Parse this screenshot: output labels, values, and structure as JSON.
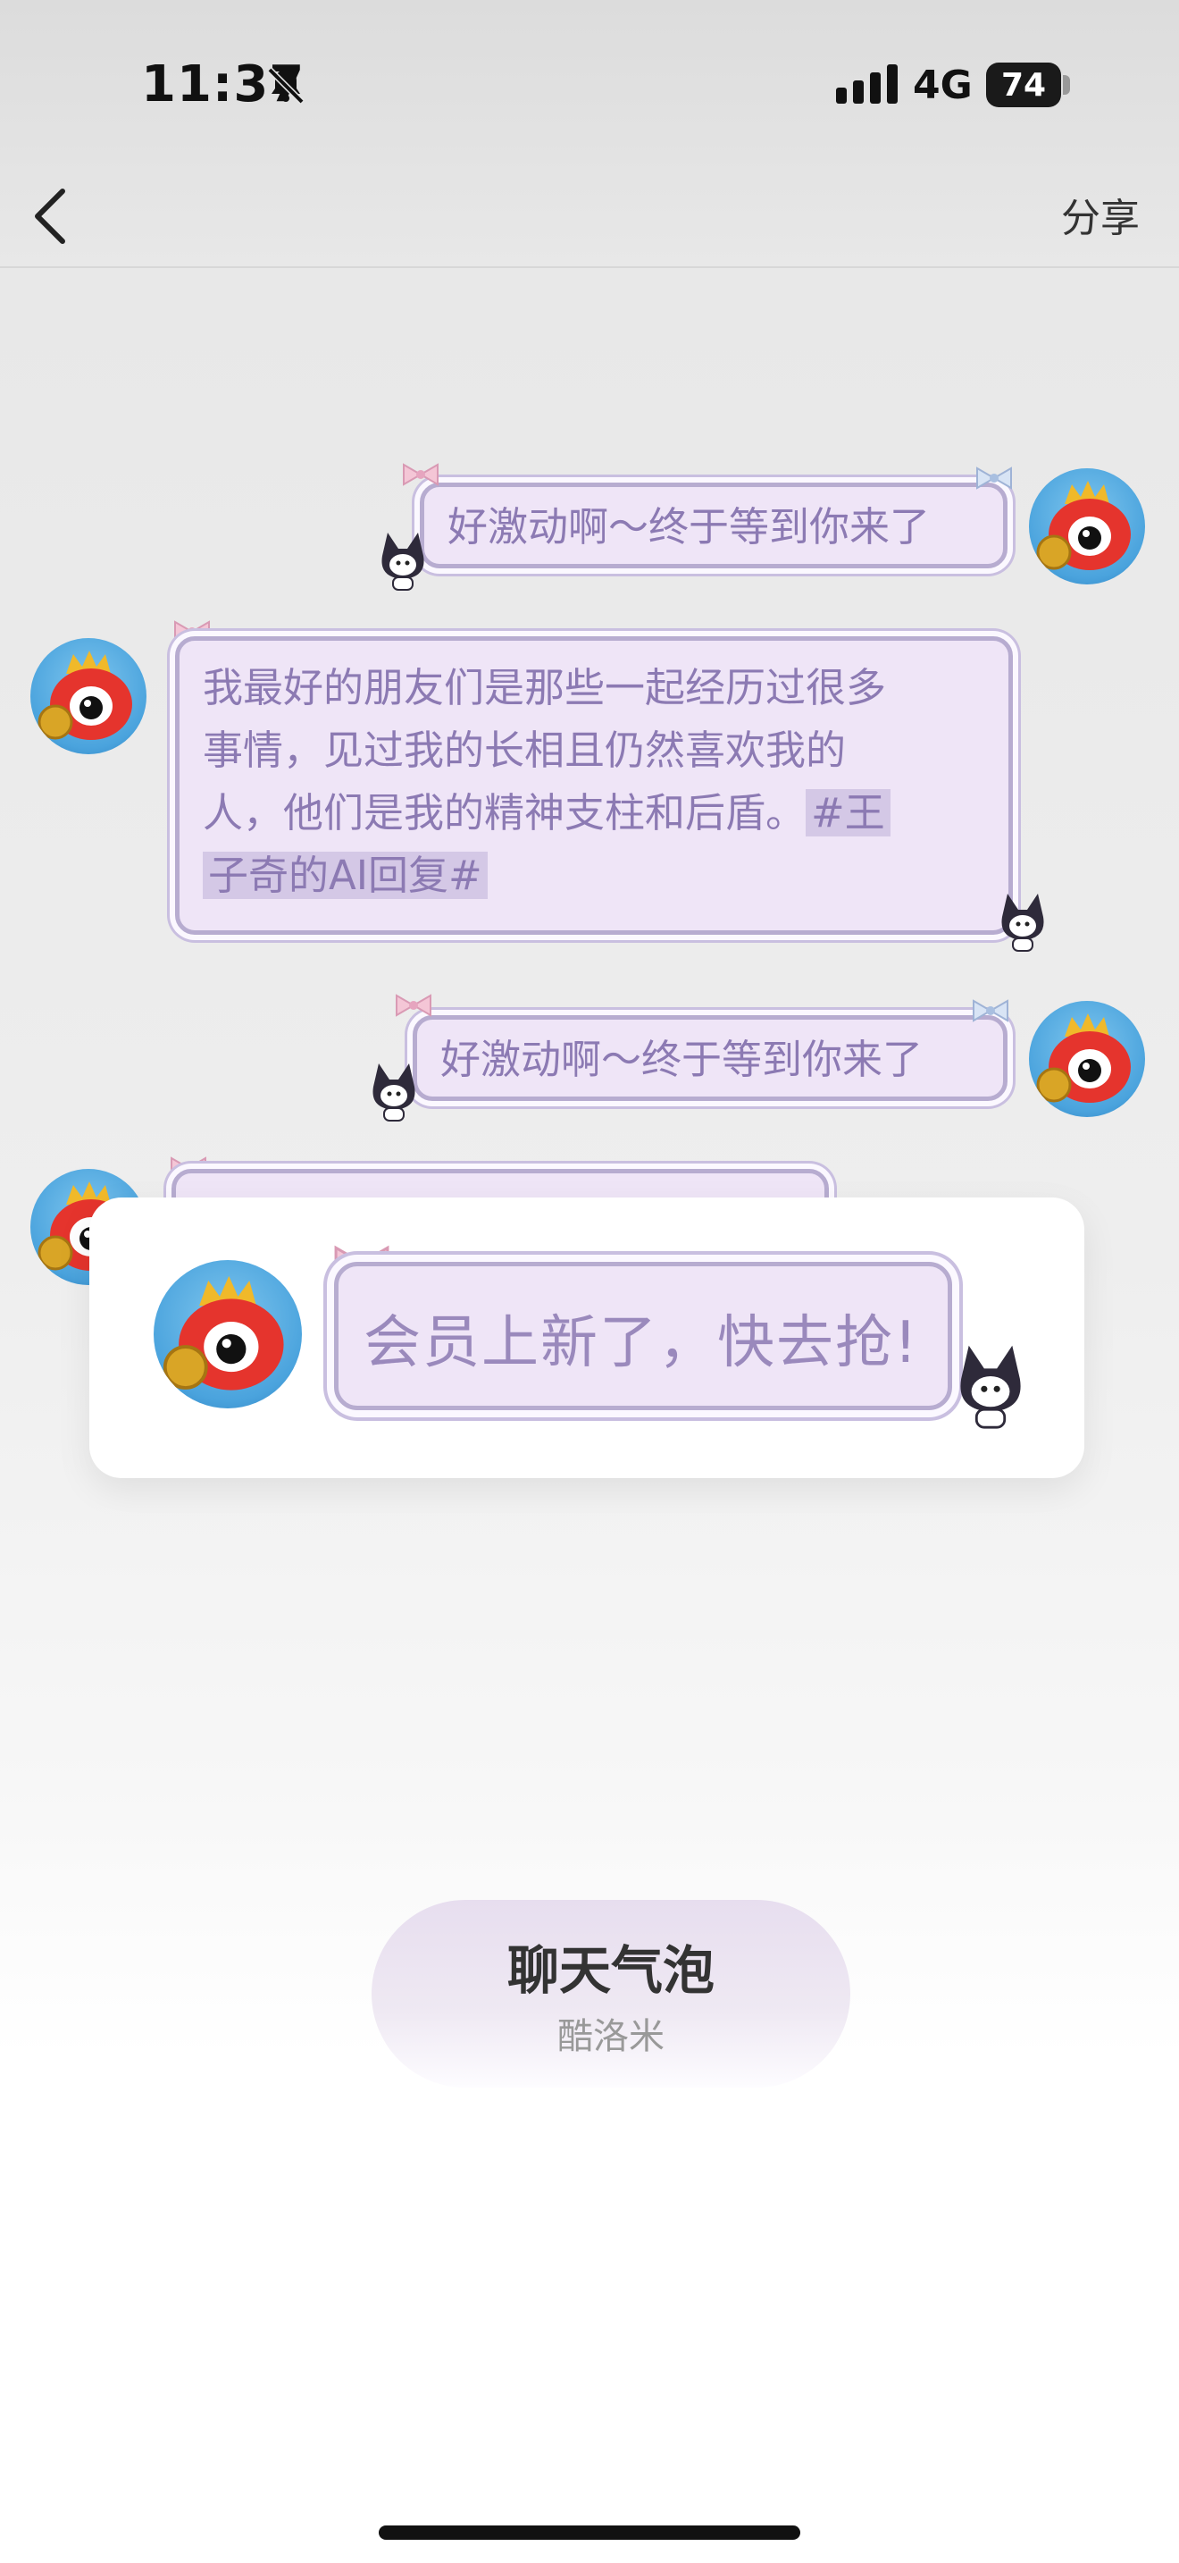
{
  "status_bar": {
    "time": "11:37",
    "network": "4G",
    "battery": "74"
  },
  "nav": {
    "share_label": "分享"
  },
  "messages": [
    {
      "side": "right",
      "text": "好激动啊～终于等到你来了"
    },
    {
      "side": "left",
      "lines": [
        "我最好的朋友们是那些一起经历过很多",
        "事情，见过我的长相且仍然喜欢我的",
        "人，他们是我的精神支柱和后盾。"
      ],
      "tag_part1": "#王",
      "tag_part2": "子奇的AI回复#"
    },
    {
      "side": "right",
      "text": "好激动啊～终于等到你来了"
    }
  ],
  "popup": {
    "text": "会员上新了，快去抢!"
  },
  "product": {
    "title": "聊天气泡",
    "subtitle": "酷洛米"
  },
  "colors": {
    "bubble_fill": "#efe5f7",
    "bubble_border": "#b7acd0",
    "bubble_text": "#8c7ab3"
  }
}
